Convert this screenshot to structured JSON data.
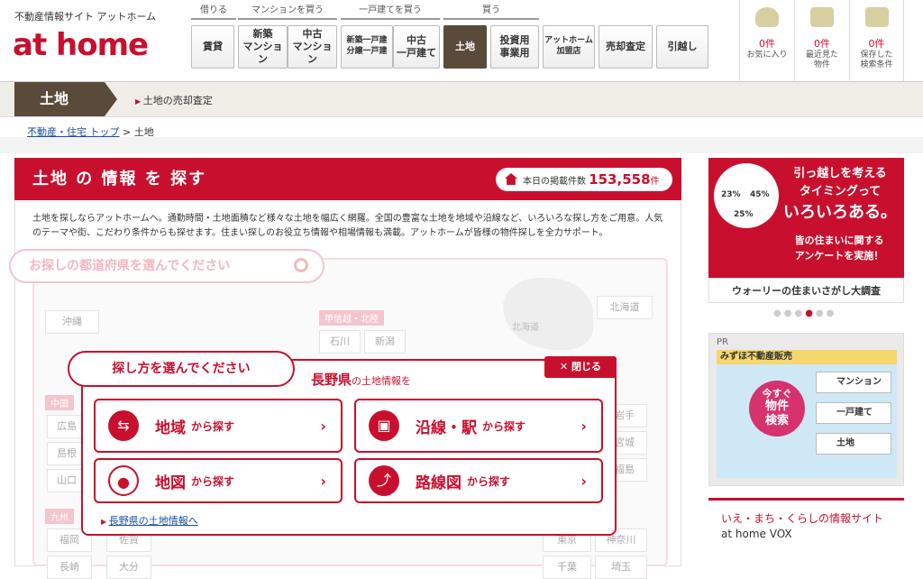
{
  "header": {
    "site_desc": "不動産情報サイト アットホーム",
    "logo": "at home",
    "groups": [
      {
        "cat": "借りる",
        "buttons": [
          "賃貸"
        ]
      },
      {
        "cat": "マンションを買う",
        "buttons": [
          "新築\nマンション",
          "中古\nマンション"
        ]
      },
      {
        "cat": "一戸建てを買う",
        "buttons": [
          "新築一戸建\n分譲一戸建",
          "中古\n一戸建て"
        ]
      },
      {
        "cat": "買う",
        "buttons": [
          "土地",
          "投資用\n事業用"
        ]
      }
    ],
    "extra_buttons": [
      "アットホーム\n加盟店",
      "売却査定",
      "引越し"
    ],
    "util": [
      {
        "count": "0件",
        "label": "お気に入り"
      },
      {
        "count": "0件",
        "label": "最近見た\n物件"
      },
      {
        "count": "0件",
        "label": "保存した\n検索条件"
      }
    ]
  },
  "bar": {
    "tag": "土地",
    "sub": "土地の売却査定"
  },
  "breadcrumb": {
    "home": "不動産・住宅 トップ",
    "sep": ">",
    "current": "土地"
  },
  "main": {
    "title": "土地 の 情報 を 探す",
    "count_label": "本日の掲載件数",
    "count_value": "153,558",
    "count_unit": "件",
    "intro": "土地を探しならアットホームへ。通勤時間・土地面積など様々な土地を幅広く網羅。全国の豊富な土地を地域や沿線など、いろいろな探し方をご用意。人気のテーマや街、こだわり条件からも探せます。住まい探しのお役立ち情報や相場情報も満載。アットホームが皆様の物件探しを全力サポート。",
    "search_placeholder": "お探しの都道府県を選んでください",
    "map": {
      "okinawa": "沖縄",
      "hokkaido": "北海道",
      "hokkaido_region": "北海道",
      "koshinetsu": "甲信越・北陸",
      "ishikawa": "石川",
      "niigata": "新潟",
      "chugoku": "中国",
      "hiroshima": "広島",
      "shimane": "島根",
      "yamaguchi": "山口",
      "kyushu": "九州",
      "fukuoka": "福岡",
      "saga": "佐賀",
      "nagasaki": "長崎",
      "oita": "大分",
      "iwate": "岩手",
      "miyagi": "宮城",
      "fukushima": "福島",
      "tokyo": "東京",
      "kanagawa": "神奈川",
      "chiba": "千葉",
      "saitama": "埼玉"
    }
  },
  "modal": {
    "tab": "探し方を選んでください",
    "title_pref": "長野県",
    "title_rest": "の土地情報を",
    "close": "閉じる",
    "options": [
      {
        "label": "地域",
        "suffix": "から探す",
        "icon": "road-sign-icon"
      },
      {
        "label": "沿線・駅",
        "suffix": "から探す",
        "icon": "train-icon"
      },
      {
        "label": "地図",
        "suffix": "から探す",
        "icon": "map-pin-icon"
      },
      {
        "label": "路線図",
        "suffix": "から探す",
        "icon": "route-icon"
      }
    ],
    "pref_link": "長野県の土地情報へ"
  },
  "sidebar": {
    "ad1_l1": "引っ越しを考える",
    "ad1_l2": "タイミングって",
    "ad1_l3": "いろいろある。",
    "ad1_s1": "皆の住まいに関する",
    "ad1_s2": "アンケートを実施！",
    "ad1_bottom": "ウォーリーの住まいさがし大調査",
    "pie_labels": [
      "23%",
      "45%",
      "25%"
    ],
    "pr_label": "PR",
    "pr_brand": "みずほ不動産販売",
    "pr_circle_top": "今すぐ",
    "pr_circle_main": "物件\n検索",
    "pr_buttons": [
      "マンション",
      "一戸建て",
      "土地"
    ],
    "vox_title": "いえ・まち・くらしの情報サイト",
    "vox_name": "at home VOX"
  },
  "colors": {
    "brand": "#c8102e",
    "dark": "#5a4a3a",
    "link": "#1a4fa0"
  }
}
